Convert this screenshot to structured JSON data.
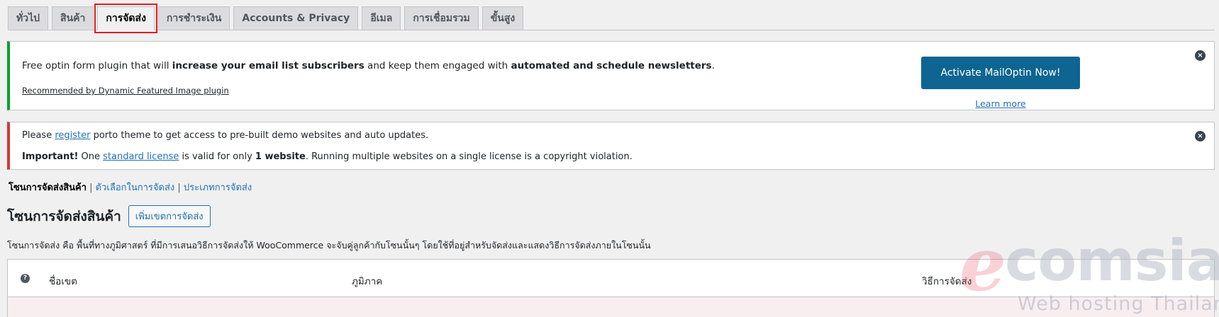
{
  "tabs": [
    {
      "label": "ทั่วไป"
    },
    {
      "label": "สินค้า"
    },
    {
      "label": "การจัดส่ง"
    },
    {
      "label": "การชำระเงิน"
    },
    {
      "label": "Accounts & Privacy"
    },
    {
      "label": "อีเมล"
    },
    {
      "label": "การเชื่อมรวม"
    },
    {
      "label": "ขั้นสูง"
    }
  ],
  "mailoptin_notice": {
    "text_1": "Free optin form plugin that will ",
    "bold_1": "increase your email list subscribers",
    "text_2": " and keep them engaged with ",
    "bold_2": "automated and schedule newsletters",
    "text_3": ".",
    "recommended": "Recommended by Dynamic Featured Image plugin",
    "button_label": "Activate MailOptin Now!",
    "learn_more": "Learn more",
    "dismiss": "×"
  },
  "porto_notice": {
    "line1_a": "Please ",
    "line1_link": "register",
    "line1_b": " porto theme to get access to pre-built demo websites and auto updates.",
    "important": "Important!",
    "line2_a": " One ",
    "line2_link": "standard license",
    "line2_b": " is valid for only ",
    "line2_bold": "1 website",
    "line2_c": ". Running multiple websites on a single license is a copyright violation.",
    "dismiss": "×"
  },
  "subnav": {
    "current": "โซนการจัดส่งสินค้า",
    "sep1": " | ",
    "item2": "ตัวเลือกในการจัดส่ง",
    "sep2": " | ",
    "item3": "ประเภทการจัดส่ง"
  },
  "heading": {
    "title": "โซนการจัดส่งสินค้า",
    "add_button": "เพิ่มเขตการจัดส่ง"
  },
  "description": "โซนการจัดส่ง คือ พื้นที่ทางภูมิศาสตร์ ที่มีการเสนอวิธีการจัดส่งให้ WooCommerce จะจับคู่ลูกค้ากับโซนนั้นๆ โดยใช้ที่อยู่สำหรับจัดส่งและแสดงวิธีการจัดส่งภายในโซนนั้น",
  "table": {
    "help": "?",
    "col_name": "ชื่อเขต",
    "col_region": "ภูมิภาค",
    "col_methods": "วิธีการจัดส่ง"
  },
  "watermark": {
    "logo_letter": "e",
    "logo_rest": "comsiam",
    "tagline": "Web hosting Thailand"
  },
  "colors": {
    "accent": "#2271b1",
    "mail_button": "#0e6591",
    "success_border": "#00a32a",
    "error_border": "#d63638",
    "tab_highlight": "#e51b1b"
  }
}
